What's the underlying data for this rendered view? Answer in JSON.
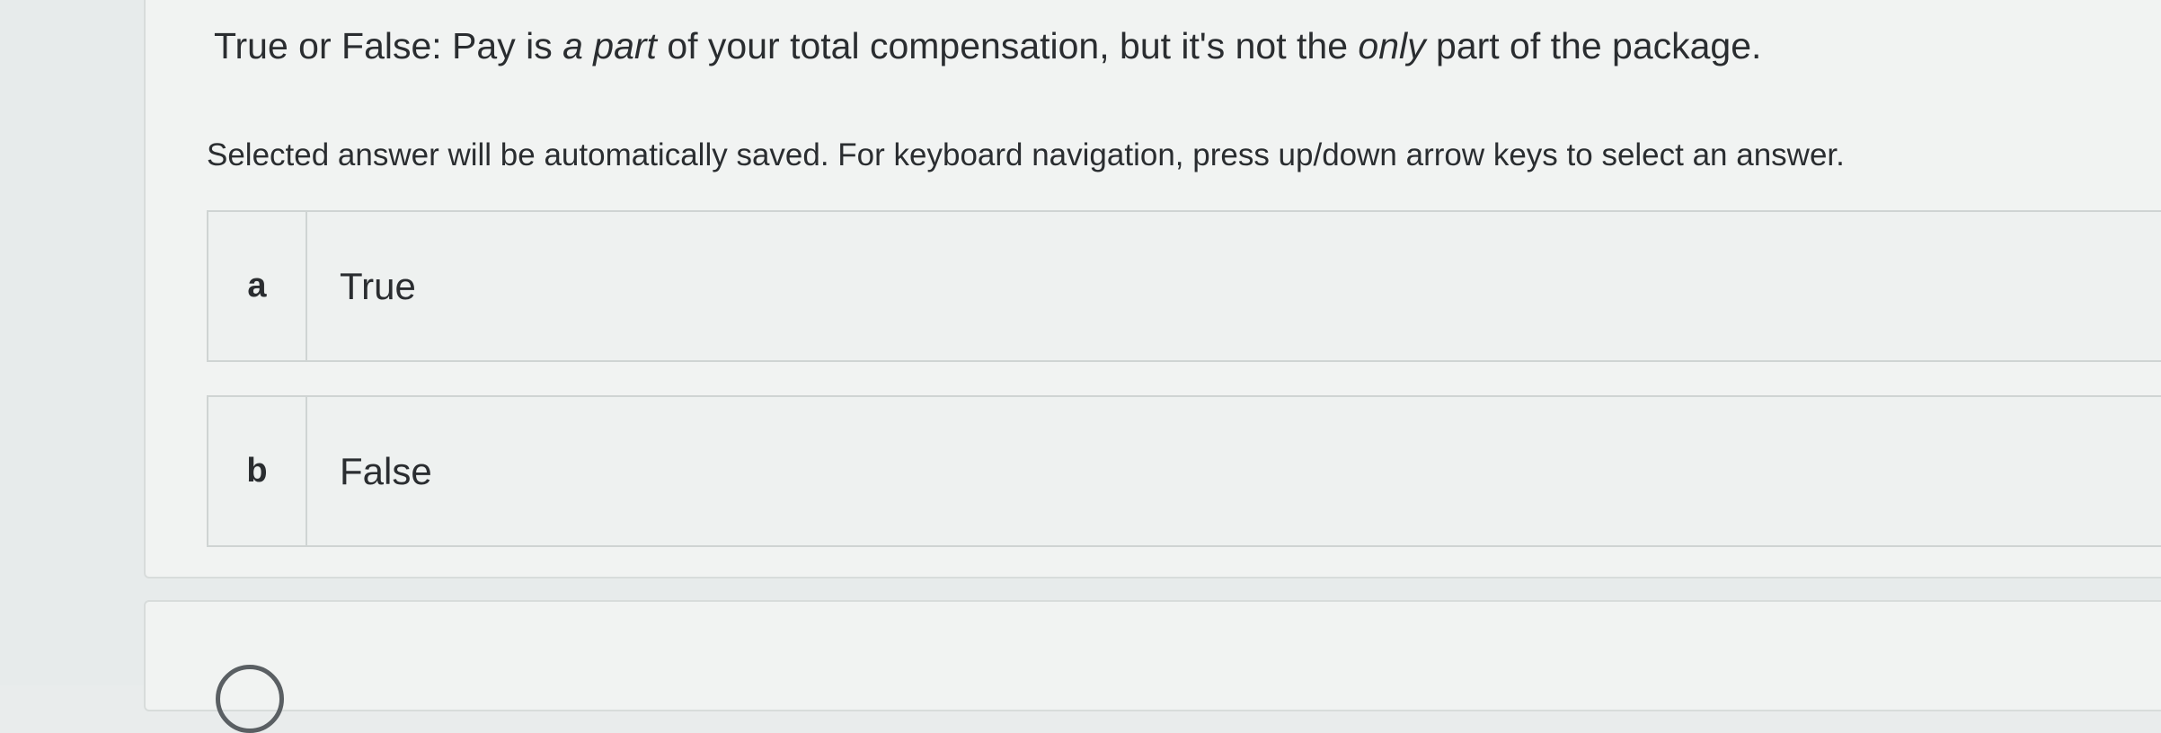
{
  "question": {
    "text_before": "True or False: Pay is ",
    "emph_1": "a part",
    "text_middle": " of your total compensation, but it's not the ",
    "emph_2": "only",
    "text_after": " part of the package."
  },
  "instructions": "Selected answer will be automatically saved. For keyboard navigation, press up/down arrow keys to select an answer.",
  "options": [
    {
      "letter": "a",
      "label": "True"
    },
    {
      "letter": "b",
      "label": "False"
    }
  ]
}
